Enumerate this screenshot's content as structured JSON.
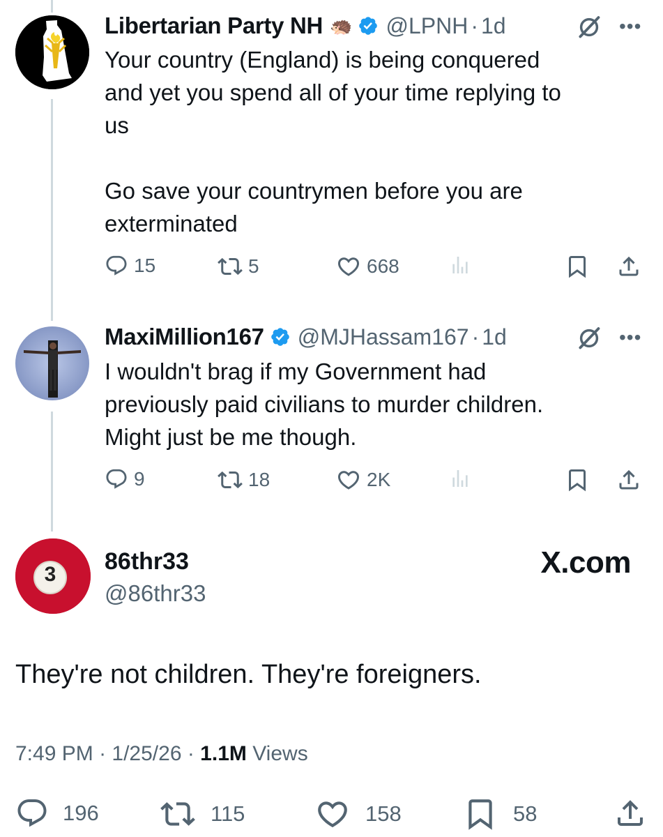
{
  "tweet1": {
    "display_name": "Libertarian Party NH",
    "emoji": "🦔",
    "handle": "@LPNH",
    "time": "1d",
    "text": "Your country (England) is being conquered\nand yet you spend all of your time replying to\nus\n\nGo save your countrymen before you are\nexterminated",
    "replies": "15",
    "reposts": "5",
    "likes": "668"
  },
  "tweet2": {
    "display_name": "MaxiMillion167",
    "handle": "@MJHassam167",
    "time": "1d",
    "text": "I wouldn't brag if my Government had\npreviously paid civilians to murder children.\nMight just be me though.",
    "replies": "9",
    "reposts": "18",
    "likes": "2K"
  },
  "main": {
    "avatar_number": "3",
    "display_name": "86thr33",
    "handle": "@86thr33",
    "watermark": "X.com",
    "text": "They're not children. They're foreigners.",
    "time": "7:49 PM",
    "date": "1/25/26",
    "views_count": "1.1M",
    "views_label": "Views",
    "replies": "196",
    "reposts": "115",
    "likes": "158",
    "bookmarks": "58"
  },
  "colors": {
    "verified": "#1d9bf0",
    "secondary_text": "#536471",
    "thread_line": "#cfd9de",
    "avatar_red": "#c8102e"
  },
  "icons": [
    "reply-icon",
    "repost-icon",
    "like-icon",
    "analytics-icon",
    "bookmark-icon",
    "share-icon",
    "grok-icon",
    "more-icon",
    "verified-badge-icon"
  ]
}
